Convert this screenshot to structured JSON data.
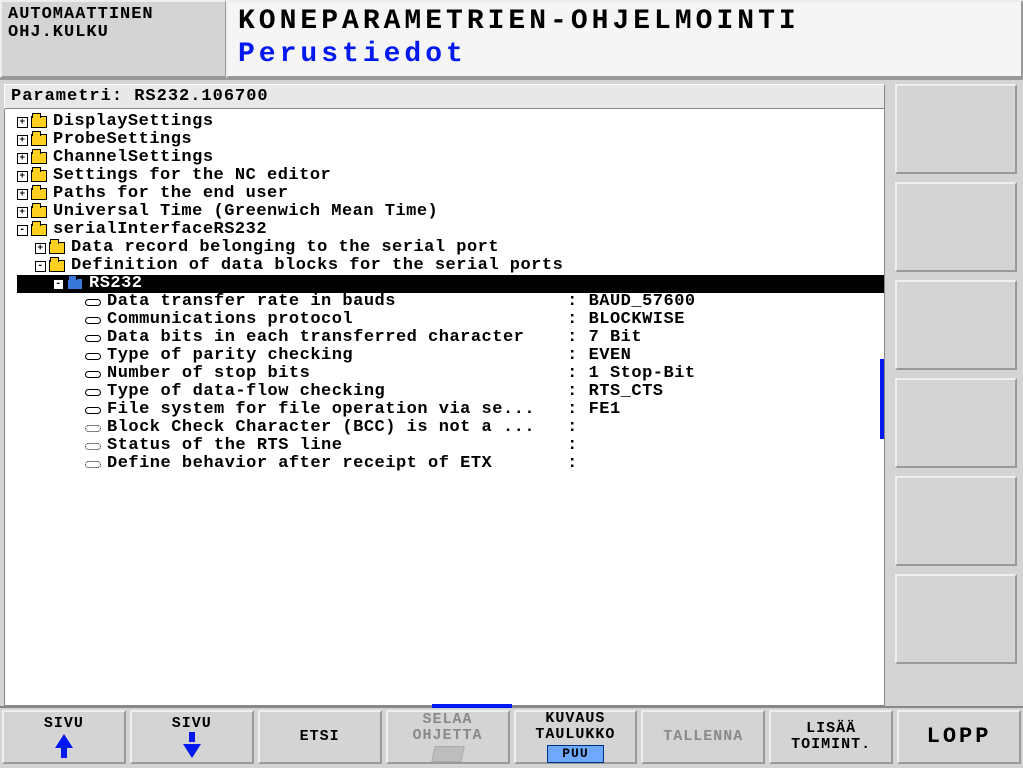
{
  "header": {
    "mode_line1": "AUTOMAATTINEN",
    "mode_line2": "OHJ.KULKU",
    "title": "KONEPARAMETRIEN-OHJELMOINTI",
    "subtitle": "Perustiedot"
  },
  "param_bar": "Parametri: RS232.106700",
  "tree": {
    "top": [
      "DisplaySettings",
      "ProbeSettings",
      "ChannelSettings",
      "Settings for the NC editor",
      "Paths for the end user",
      "Universal Time (Greenwich Mean Time)",
      "serialInterfaceRS232"
    ],
    "serial_children": [
      "Data record belonging to the serial port",
      "Definition of data blocks for the serial ports"
    ],
    "selected": "RS232",
    "params": [
      {
        "label": "Data transfer rate in bauds",
        "value": "BAUD_57600",
        "dotted": false
      },
      {
        "label": "Communications protocol",
        "value": "BLOCKWISE",
        "dotted": false
      },
      {
        "label": "Data bits in each transferred character",
        "value": "7 Bit",
        "dotted": false
      },
      {
        "label": "Type of parity checking",
        "value": "EVEN",
        "dotted": false
      },
      {
        "label": "Number of stop bits",
        "value": "1 Stop-Bit",
        "dotted": false
      },
      {
        "label": "Type of data-flow checking",
        "value": "RTS_CTS",
        "dotted": false
      },
      {
        "label": "File system for file operation via se...",
        "value": "FE1",
        "dotted": false
      },
      {
        "label": "Block Check Character (BCC) is not a ...",
        "value": "",
        "dotted": true
      },
      {
        "label": "Status of the RTS line",
        "value": "",
        "dotted": true
      },
      {
        "label": "Define behavior after receipt of ETX",
        "value": "",
        "dotted": true
      }
    ]
  },
  "softkeys": {
    "sk1": "SIVU",
    "sk2": "SIVU",
    "sk3": "ETSI",
    "sk4a": "SELAA",
    "sk4b": "OHJETTA",
    "sk5a": "KUVAUS",
    "sk5b": "TAULUKKO",
    "sk5c": "PUU",
    "sk6": "TALLENNA",
    "sk7a": "LISÄÄ",
    "sk7b": "TOIMINT.",
    "sk8": "LOPP"
  }
}
